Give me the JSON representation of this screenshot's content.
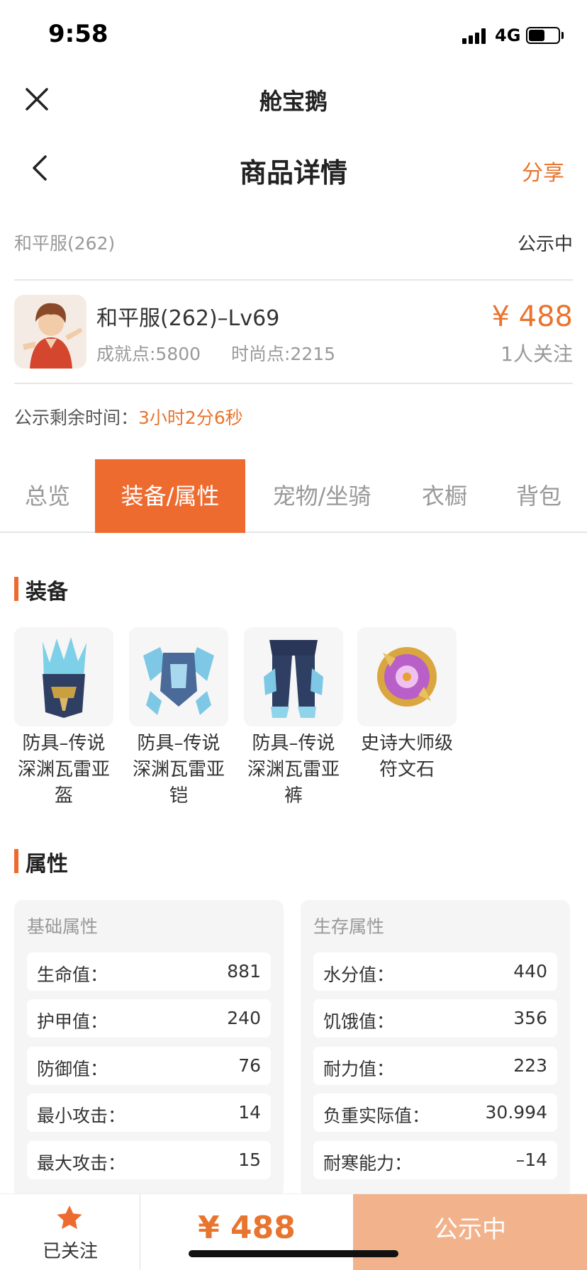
{
  "status_bar": {
    "time": "9:58",
    "network": "4G",
    "battery_level": 0.55
  },
  "app": {
    "title": "舱宝鹅"
  },
  "nav": {
    "title": "商品详情",
    "share_label": "分享"
  },
  "server": {
    "name": "和平服(262)",
    "status": "公示中"
  },
  "product": {
    "name": "和平服(262)–Lv69",
    "achievement": "成就点:5800",
    "fashion": "时尚点:2215",
    "price": "¥ 488",
    "followers": "1人关注"
  },
  "countdown": {
    "label": "公示剩余时间：",
    "value": "3小时2分6秒"
  },
  "tabs": [
    {
      "label": "总览"
    },
    {
      "label": "装备/属性"
    },
    {
      "label": "宠物/坐骑"
    },
    {
      "label": "衣橱"
    },
    {
      "label": "背包"
    }
  ],
  "equipment": {
    "title": "装备",
    "items": [
      {
        "line1": "防具–传说",
        "line2": "深渊瓦雷亚",
        "line3": "盔"
      },
      {
        "line1": "防具–传说",
        "line2": "深渊瓦雷亚",
        "line3": "铠"
      },
      {
        "line1": "防具–传说",
        "line2": "深渊瓦雷亚",
        "line3": "裤"
      },
      {
        "line1": "史诗大师级",
        "line2": "符文石",
        "line3": ""
      }
    ]
  },
  "attributes": {
    "title": "属性",
    "basic": {
      "title": "基础属性",
      "rows": [
        {
          "k": "生命值：",
          "v": "881"
        },
        {
          "k": "护甲值：",
          "v": "240"
        },
        {
          "k": "防御值：",
          "v": "76"
        },
        {
          "k": "最小攻击：",
          "v": "14"
        },
        {
          "k": "最大攻击：",
          "v": "15"
        }
      ]
    },
    "survival": {
      "title": "生存属性",
      "rows": [
        {
          "k": "水分值：",
          "v": "440"
        },
        {
          "k": "饥饿值：",
          "v": "356"
        },
        {
          "k": "耐力值：",
          "v": "223"
        },
        {
          "k": "负重实际值：",
          "v": "30.994"
        },
        {
          "k": "耐寒能力：",
          "v": "–14"
        }
      ]
    }
  },
  "bottom": {
    "follow_label": "已关注",
    "price": "¥ 488",
    "action_label": "公示中"
  },
  "colors": {
    "accent": "#ee6b30",
    "price": "#e8752f",
    "action_bg": "#f2b38c"
  }
}
